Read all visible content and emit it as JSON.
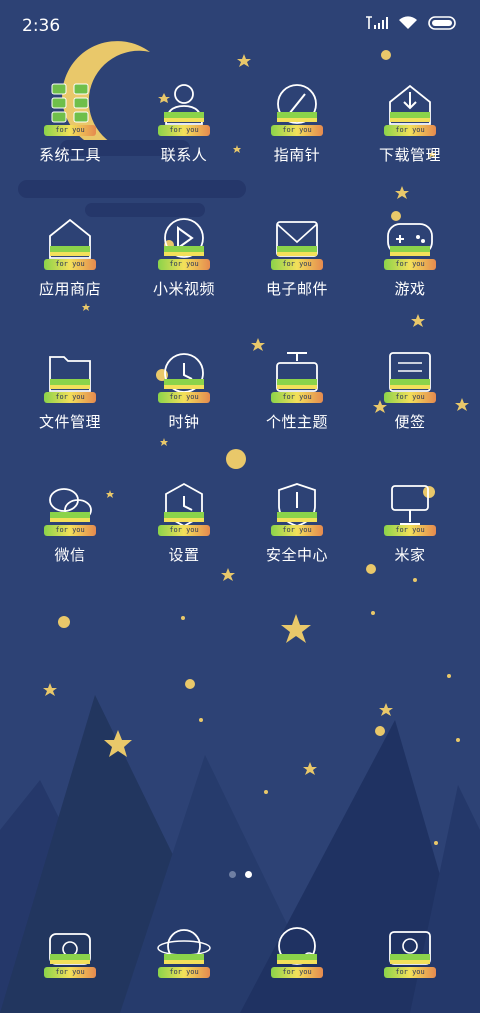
{
  "status_bar": {
    "time": "2:36"
  },
  "apps": [
    {
      "label": "系统工具",
      "icon": "tools-icon",
      "badge": "for you"
    },
    {
      "label": "联系人",
      "icon": "contacts-icon",
      "badge": "for you"
    },
    {
      "label": "指南针",
      "icon": "compass-icon",
      "badge": "for you"
    },
    {
      "label": "下载管理",
      "icon": "download-icon",
      "badge": "for you"
    },
    {
      "label": "应用商店",
      "icon": "store-icon",
      "badge": "for you"
    },
    {
      "label": "小米视频",
      "icon": "video-icon",
      "badge": "for you"
    },
    {
      "label": "电子邮件",
      "icon": "mail-icon",
      "badge": "for you"
    },
    {
      "label": "游戏",
      "icon": "gamepad-icon",
      "badge": "for you"
    },
    {
      "label": "文件管理",
      "icon": "folder-icon",
      "badge": "for you"
    },
    {
      "label": "时钟",
      "icon": "clock-icon",
      "badge": "for you"
    },
    {
      "label": "个性主题",
      "icon": "theme-icon",
      "badge": "for you"
    },
    {
      "label": "便签",
      "icon": "notes-icon",
      "badge": "for you"
    },
    {
      "label": "微信",
      "icon": "wechat-icon",
      "badge": "for you"
    },
    {
      "label": "设置",
      "icon": "settings-icon",
      "badge": "for you"
    },
    {
      "label": "安全中心",
      "icon": "shield-icon",
      "badge": "for you"
    },
    {
      "label": "米家",
      "icon": "mijia-icon",
      "badge": "for you"
    }
  ],
  "dock": [
    {
      "icon": "phone-icon",
      "badge": "for you"
    },
    {
      "icon": "planet-icon",
      "badge": "for you"
    },
    {
      "icon": "browser-icon",
      "badge": "for you"
    },
    {
      "icon": "camera-icon",
      "badge": "for you"
    }
  ],
  "pager": {
    "pages": 2,
    "active_index": 1
  },
  "colors": {
    "background": "#2d4275",
    "moon": "#e9c86a",
    "mountain": "#1f3262",
    "star": "#e9c86a"
  }
}
